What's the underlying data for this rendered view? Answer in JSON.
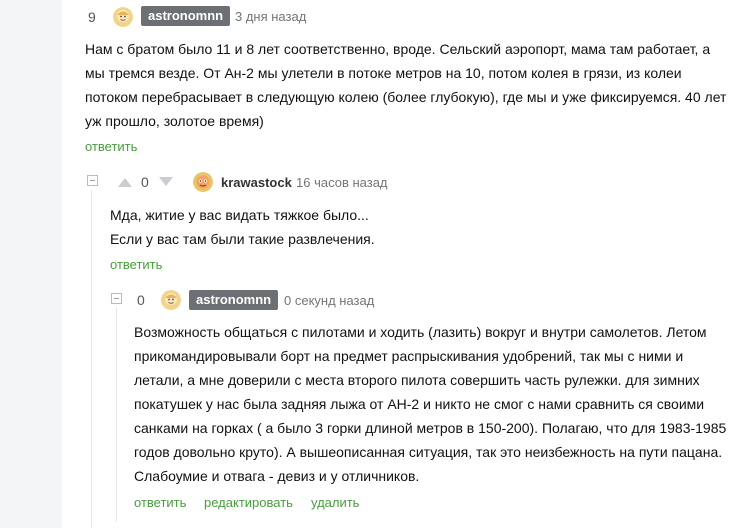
{
  "comments": [
    {
      "rating": "9",
      "author": "astronomnn",
      "time": "3 дня назад",
      "lines": [
        "Нам с братом было 11 и 8 лет соответственно, вроде. Сельский аэропорт, мама там работает, а",
        "мы тремся везде. От Ан-2 мы улетели в потоке метров на 10, потом колея в грязи, из колеи",
        "потоком перебрасывает в следующую колею (более глубокую), где мы и уже фиксируемся. 40 лет",
        "уж прошло, золотое время)"
      ],
      "reply_label": "ответить"
    },
    {
      "rating": "0",
      "author": "krawastock",
      "time": "16 часов назад",
      "lines": [
        "Мда, житие у вас видать тяжкое было...",
        "Если у вас там были такие развлечения."
      ],
      "reply_label": "ответить"
    },
    {
      "rating": "0",
      "author": "astronomnn",
      "time": "0 секунд назад",
      "lines": [
        "Возможность общаться с пилотами и ходить (лазить) вокруг и внутри самолетов. Летом",
        "прикомандировывали борт на предмет распрыскивания удобрений, так мы с ними и",
        "летали, а мне доверили с места второго пилота совершить часть рулежки. для зимних",
        "покатушек у нас была задняя лыжа от АН-2 и никто не смог с нами сравнить ся своими",
        "санками на горках ( а было 3 горки длиной метров в 150-200). Полагаю, что для 1983-1985",
        "годов довольно круто). А вышеописанная ситуация, так это неизбежность на пути пацана.",
        "Слабоумие и отвага - девиз и у отличников."
      ],
      "reply_label": "ответить",
      "edit_label": "редактировать",
      "delete_label": "удалить"
    }
  ],
  "colors": {
    "link": "#4a9c3f",
    "badge": "#6c7075",
    "muted": "#727578"
  }
}
